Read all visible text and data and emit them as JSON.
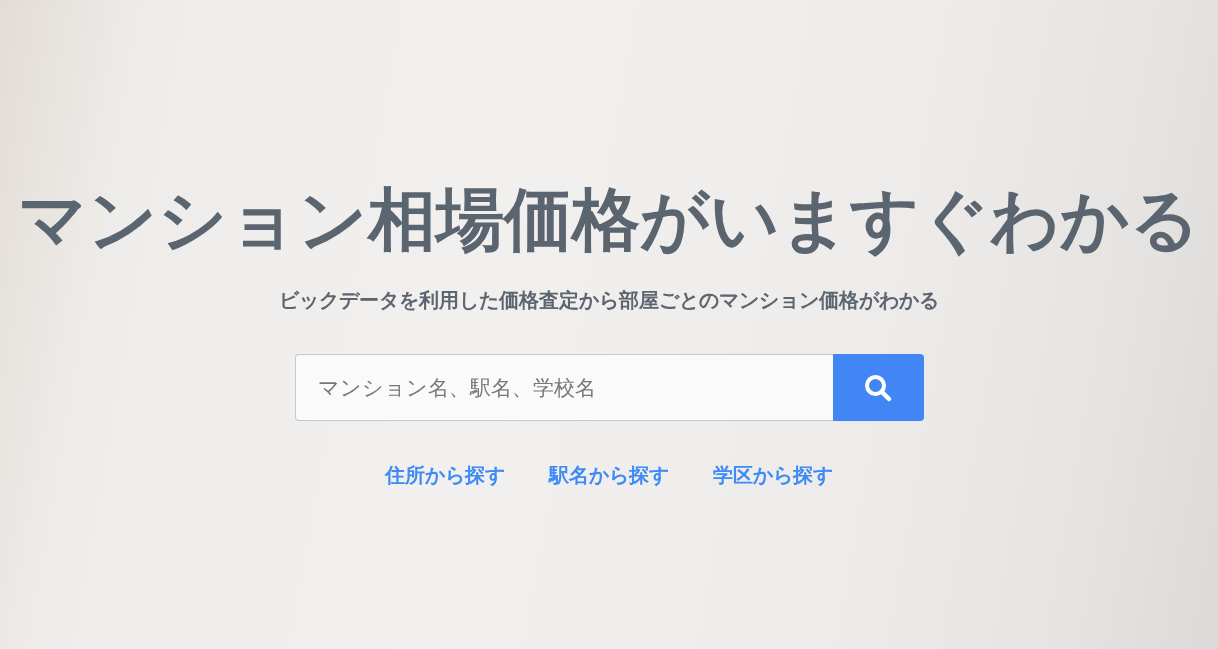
{
  "hero": {
    "title": "マンション相場価格がいますぐわかる",
    "subtitle": "ビックデータを利用した価格査定から部屋ごとのマンション価格がわかる"
  },
  "search": {
    "placeholder": "マンション名、駅名、学校名"
  },
  "links": [
    {
      "label": "住所から探す"
    },
    {
      "label": "駅名から探す"
    },
    {
      "label": "学区から探す"
    }
  ]
}
